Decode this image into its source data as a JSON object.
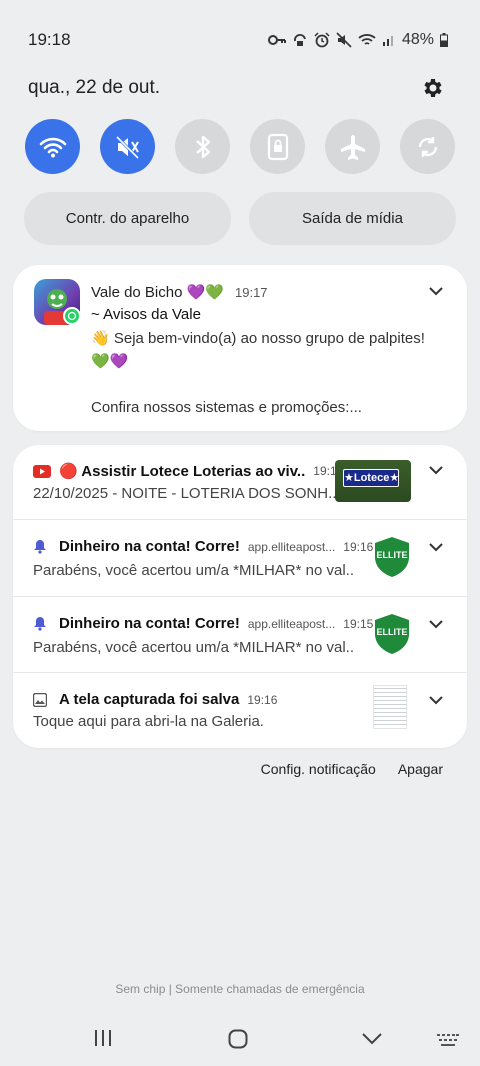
{
  "status": {
    "time": "19:18",
    "battery": "48%"
  },
  "header": {
    "date": "qua., 22 de out."
  },
  "quick_settings": [
    {
      "name": "Wi-Fi",
      "state": "on"
    },
    {
      "name": "Som",
      "state": "on"
    },
    {
      "name": "Bluetooth",
      "state": "off"
    },
    {
      "name": "Rotação",
      "state": "off"
    },
    {
      "name": "Modo avião",
      "state": "off"
    },
    {
      "name": "Sincronizar",
      "state": "off"
    }
  ],
  "pills": {
    "device_control": "Contr. do aparelho",
    "media_output": "Saída de mídia"
  },
  "whatsapp": {
    "app": "Vale do Bicho 💜💚",
    "time": "19:17",
    "title": "~ Avisos da Vale",
    "body": "👋 Seja bem-vindo(a) ao nosso grupo de palpites! 💚💜",
    "body2": "Confira nossos sistemas e promoções:..."
  },
  "notifications": [
    {
      "title": "🔴 Assistir Lotece Loterias ao viv..",
      "app": "",
      "time": "19:15",
      "text": "22/10/2025 - NOITE - LOTERIA DOS SONH..",
      "thumb_label": "★Lotece★"
    },
    {
      "title": "Dinheiro na conta! Corre!",
      "app": "app.elliteapost...",
      "time": "19:16",
      "text": "Parabéns, você acertou um/a *MILHAR* no val..",
      "thumb_label": "ELLITE"
    },
    {
      "title": "Dinheiro na conta! Corre!",
      "app": "app.elliteapost...",
      "time": "19:15",
      "text": "Parabéns, você acertou um/a *MILHAR* no val..",
      "thumb_label": "ELLITE"
    },
    {
      "title": "A tela capturada foi salva",
      "app": "",
      "time": "19:16",
      "text": "Toque aqui para abri-la na Galeria.",
      "thumb_label": ""
    }
  ],
  "actions": {
    "settings": "Config. notificação",
    "clear": "Apagar"
  },
  "carrier": "Sem chip | Somente chamadas de emergência",
  "colors": {
    "accent": "#3a73e9",
    "background": "#eceeef",
    "card": "#ffffff"
  }
}
